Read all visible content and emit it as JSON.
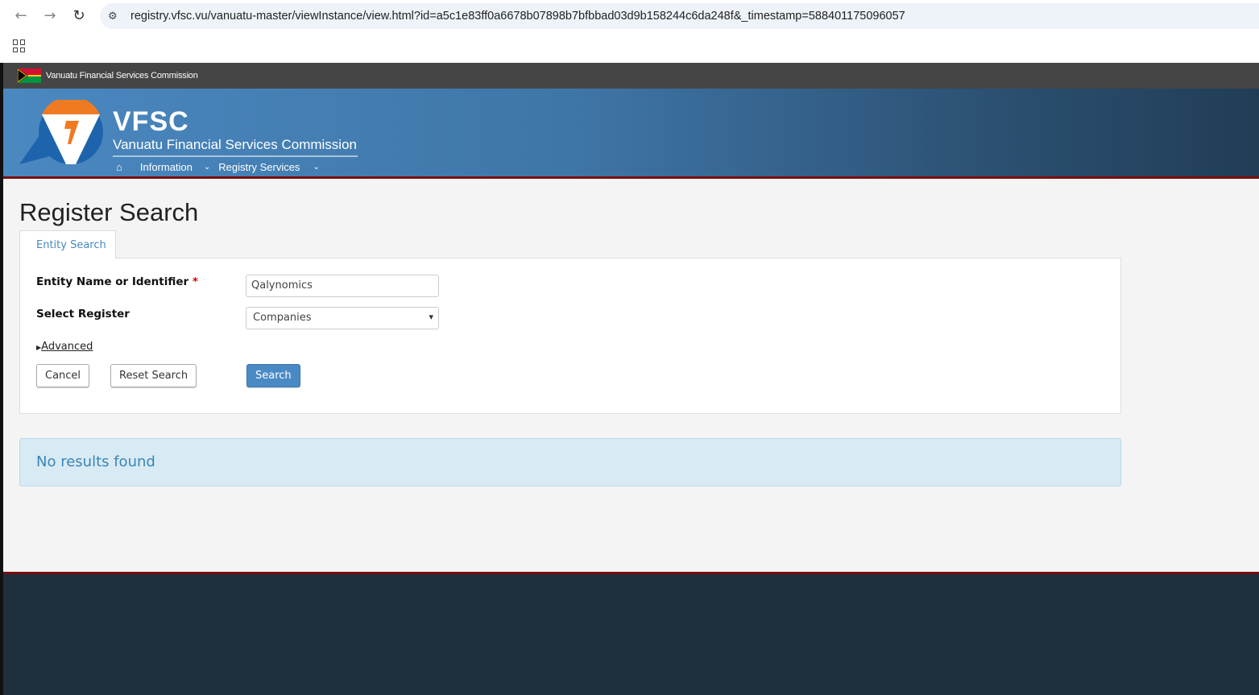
{
  "browser": {
    "url": "registry.vfsc.vu/vanuatu-master/viewInstance/view.html?id=a5c1e83ff0a6678b07898b7bfbbad03d9b158244c6da248f&_timestamp=588401175096057"
  },
  "topbar": {
    "title": "Vanuatu Financial Services Commission"
  },
  "header": {
    "acronym": "VFSC",
    "name": "Vanuatu Financial Services Commission",
    "menu": [
      "Information",
      "Registry Services"
    ]
  },
  "page": {
    "title": "Register Search",
    "tab": "Entity Search"
  },
  "form": {
    "entity_label": "Entity Name or Identifier",
    "required_mark": "*",
    "entity_value": "Qalynomics",
    "register_label": "Select Register",
    "register_value": "Companies",
    "advanced": "Advanced",
    "cancel": "Cancel",
    "reset": "Reset Search",
    "search": "Search"
  },
  "result": {
    "message": "No results found"
  },
  "colors": {
    "accent": "#4a8ac4",
    "brand_red": "#7a0e0e",
    "footer": "#1e2f3e"
  }
}
